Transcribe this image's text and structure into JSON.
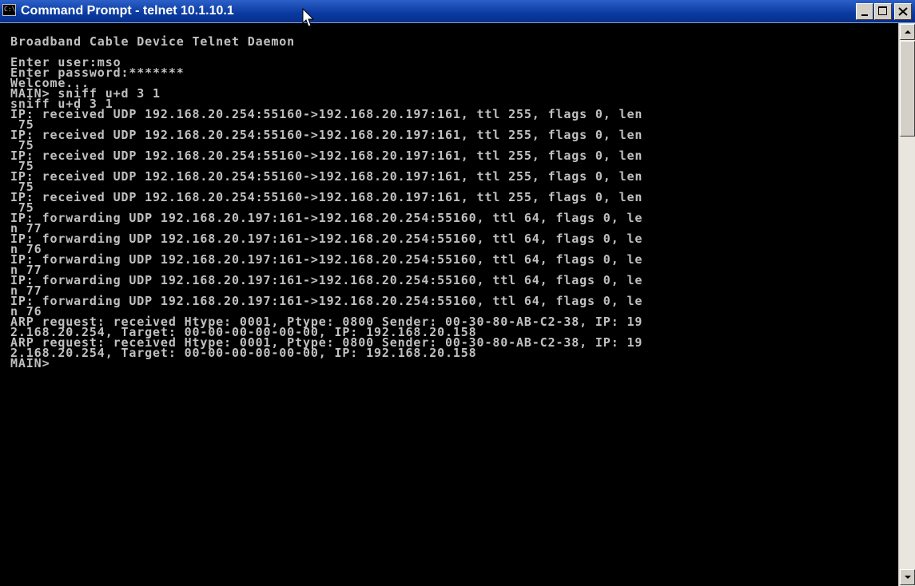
{
  "window": {
    "title": "Command Prompt - telnet 10.1.10.1",
    "title_icon_text": "C:\\"
  },
  "console": {
    "lines": [
      "Broadband Cable Device Telnet Daemon",
      "",
      "Enter user:mso",
      "Enter password:*******",
      "Welcome...",
      "MAIN> sniff u+d 3 1",
      "sniff u+d 3 1",
      "IP: received UDP 192.168.20.254:55160->192.168.20.197:161, ttl 255, flags 0, len",
      " 75",
      "IP: received UDP 192.168.20.254:55160->192.168.20.197:161, ttl 255, flags 0, len",
      " 75",
      "IP: received UDP 192.168.20.254:55160->192.168.20.197:161, ttl 255, flags 0, len",
      " 75",
      "IP: received UDP 192.168.20.254:55160->192.168.20.197:161, ttl 255, flags 0, len",
      " 75",
      "IP: received UDP 192.168.20.254:55160->192.168.20.197:161, ttl 255, flags 0, len",
      " 75",
      "IP: forwarding UDP 192.168.20.197:161->192.168.20.254:55160, ttl 64, flags 0, le",
      "n 77",
      "IP: forwarding UDP 192.168.20.197:161->192.168.20.254:55160, ttl 64, flags 0, le",
      "n 76",
      "IP: forwarding UDP 192.168.20.197:161->192.168.20.254:55160, ttl 64, flags 0, le",
      "n 77",
      "IP: forwarding UDP 192.168.20.197:161->192.168.20.254:55160, ttl 64, flags 0, le",
      "n 77",
      "IP: forwarding UDP 192.168.20.197:161->192.168.20.254:55160, ttl 64, flags 0, le",
      "n 76",
      "ARP request: received Htype: 0001, Ptype: 0800 Sender: 00-30-80-AB-C2-38, IP: 19",
      "2.168.20.254, Target: 00-00-00-00-00-00, IP: 192.168.20.158",
      "ARP request: received Htype: 0001, Ptype: 0800 Sender: 00-30-80-AB-C2-38, IP: 19",
      "2.168.20.254, Target: 00-00-00-00-00-00, IP: 192.168.20.158",
      "MAIN>"
    ]
  },
  "icons": {
    "window_icon": "command-prompt-icon",
    "minimize": "minimize-icon",
    "maximize": "maximize-icon",
    "close": "close-icon",
    "scroll_up": "arrow-up-icon",
    "scroll_down": "arrow-down-icon",
    "mouse_cursor": "mouse-pointer-icon"
  },
  "colors": {
    "titlebar": "#0a3aa0",
    "console_background": "#000000",
    "console_text": "#c0c0c0"
  }
}
